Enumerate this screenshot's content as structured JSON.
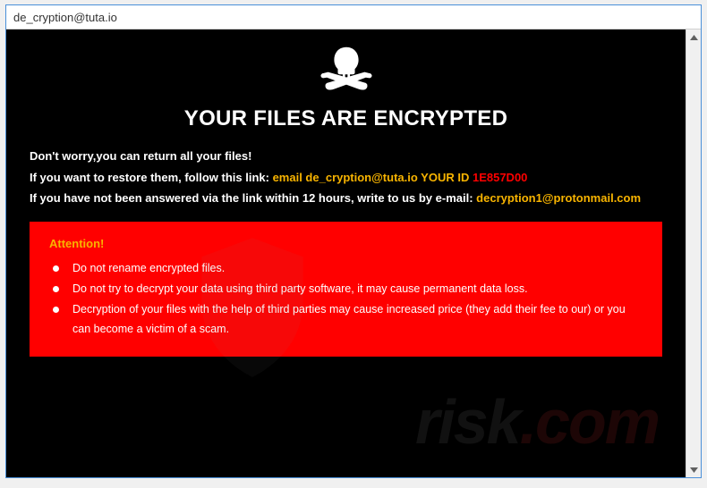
{
  "window": {
    "title": "de_cryption@tuta.io"
  },
  "content": {
    "heading": "YOUR FILES ARE ENCRYPTED",
    "line1": "Don't worry,you can return all your files!",
    "line2_prefix": "If you want to restore them, follow this link: ",
    "line2_email_label": "email de_cryption@tuta.io",
    "line2_id_label": "   YOUR ID ",
    "line2_id_value": "1E857D00",
    "line3_prefix": "If you have not been answered via the link within 12 hours, write to us by e-mail: ",
    "line3_email": "decryption1@protonmail.com",
    "attention": {
      "title": "Attention!",
      "items": [
        "Do not rename encrypted files.",
        "Do not try to decrypt your data using third party software, it may cause permanent data loss.",
        "Decryption of your files with the help of third parties may cause increased price (they add their fee to our) or you can become a victim of a scam."
      ]
    }
  },
  "watermark": {
    "text_plain": "risk",
    "text_accent": ".com"
  },
  "colors": {
    "accent_orange": "#f8b400",
    "danger_red": "#ff0000"
  }
}
